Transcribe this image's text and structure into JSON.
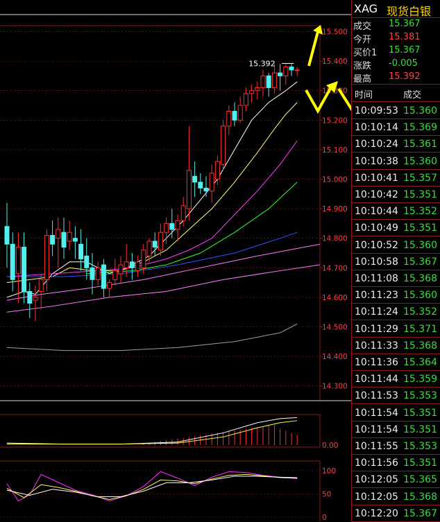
{
  "header": {
    "symbol": "XAG",
    "name": "现货白银"
  },
  "quote": [
    {
      "label": "成交",
      "value": "15.367",
      "color": "green"
    },
    {
      "label": "今开",
      "value": "15.381",
      "color": "red"
    },
    {
      "label": "买价1",
      "value": "15.367",
      "color": "green"
    },
    {
      "label": "涨跌",
      "value": "-0.005",
      "color": "green"
    },
    {
      "label": "最高",
      "value": "15.392",
      "color": "red"
    }
  ],
  "ticks_header": {
    "time": "时间",
    "price": "成交"
  },
  "ticks": [
    {
      "time": "10:09:53",
      "price": "15.360"
    },
    {
      "time": "10:10:14",
      "price": "15.369"
    },
    {
      "time": "10:10:24",
      "price": "15.361"
    },
    {
      "time": "10:10:38",
      "price": "15.360"
    },
    {
      "time": "10:10:41",
      "price": "15.357"
    },
    {
      "time": "10:10:42",
      "price": "15.351"
    },
    {
      "time": "10:10:44",
      "price": "15.352"
    },
    {
      "time": "10:10:49",
      "price": "15.351"
    },
    {
      "time": "10:10:52",
      "price": "15.360"
    },
    {
      "time": "10:10:58",
      "price": "15.367"
    },
    {
      "time": "10:11:08",
      "price": "15.368"
    },
    {
      "time": "10:11:23",
      "price": "15.360"
    },
    {
      "time": "10:11:24",
      "price": "15.352"
    },
    {
      "time": "10:11:29",
      "price": "15.371"
    },
    {
      "time": "10:11:33",
      "price": "15.368"
    },
    {
      "time": "10:11:36",
      "price": "15.364"
    },
    {
      "time": "10:11:44",
      "price": "15.359"
    },
    {
      "time": "10:11:53",
      "price": "15.353"
    },
    {
      "time": "10:11:54",
      "price": "15.351"
    },
    {
      "time": "10:11:54",
      "price": "15.351"
    },
    {
      "time": "10:11:55",
      "price": "15.353"
    },
    {
      "time": "10:11:56",
      "price": "15.351"
    },
    {
      "time": "10:12:05",
      "price": "15.365"
    },
    {
      "time": "10:12:05",
      "price": "15.368"
    },
    {
      "time": "10:12:20",
      "price": "15.367"
    }
  ],
  "colors": {
    "up": "#ff3030",
    "down": "#50f0f0",
    "grid": "#8b1a1a",
    "green": "#3ddc3d",
    "red": "#ff4040"
  },
  "chart_data": [
    {
      "type": "candlestick",
      "ylim": [
        14.25,
        15.52
      ],
      "ticks": [
        "15.500",
        "15.400",
        "15.300",
        "15.200",
        "15.100",
        "15.000",
        "14.900",
        "14.800",
        "14.700",
        "14.600",
        "14.500",
        "14.400",
        "14.300"
      ],
      "annotation": "15.392",
      "candles": [
        {
          "o": 14.84,
          "h": 14.92,
          "l": 14.7,
          "c": 14.78
        },
        {
          "o": 14.78,
          "h": 14.82,
          "l": 14.62,
          "c": 14.66
        },
        {
          "o": 14.68,
          "h": 14.82,
          "l": 14.58,
          "c": 14.77
        },
        {
          "o": 14.77,
          "h": 14.82,
          "l": 14.58,
          "c": 14.62
        },
        {
          "o": 14.62,
          "h": 14.65,
          "l": 14.53,
          "c": 14.58
        },
        {
          "o": 14.59,
          "h": 14.64,
          "l": 14.52,
          "c": 14.6
        },
        {
          "o": 14.62,
          "h": 14.68,
          "l": 14.56,
          "c": 14.66
        },
        {
          "o": 14.66,
          "h": 14.83,
          "l": 14.62,
          "c": 14.81
        },
        {
          "o": 14.81,
          "h": 14.86,
          "l": 14.74,
          "c": 14.78
        },
        {
          "o": 14.8,
          "h": 14.87,
          "l": 14.7,
          "c": 14.83
        },
        {
          "o": 14.82,
          "h": 14.87,
          "l": 14.73,
          "c": 14.77
        },
        {
          "o": 14.79,
          "h": 14.86,
          "l": 14.76,
          "c": 14.82
        },
        {
          "o": 14.8,
          "h": 14.84,
          "l": 14.73,
          "c": 14.79
        },
        {
          "o": 14.78,
          "h": 14.83,
          "l": 14.69,
          "c": 14.73
        },
        {
          "o": 14.74,
          "h": 14.8,
          "l": 14.66,
          "c": 14.7
        },
        {
          "o": 14.7,
          "h": 14.75,
          "l": 14.61,
          "c": 14.66
        },
        {
          "o": 14.66,
          "h": 14.72,
          "l": 14.64,
          "c": 14.7
        },
        {
          "o": 14.71,
          "h": 14.73,
          "l": 14.6,
          "c": 14.63
        },
        {
          "o": 14.63,
          "h": 14.66,
          "l": 14.6,
          "c": 14.65
        },
        {
          "o": 14.66,
          "h": 14.73,
          "l": 14.64,
          "c": 14.69
        },
        {
          "o": 14.68,
          "h": 14.74,
          "l": 14.65,
          "c": 14.71
        },
        {
          "o": 14.7,
          "h": 14.78,
          "l": 14.67,
          "c": 14.72
        },
        {
          "o": 14.72,
          "h": 14.75,
          "l": 14.66,
          "c": 14.7
        },
        {
          "o": 14.69,
          "h": 14.74,
          "l": 14.67,
          "c": 14.72
        },
        {
          "o": 14.7,
          "h": 14.78,
          "l": 14.68,
          "c": 14.76
        },
        {
          "o": 14.74,
          "h": 14.8,
          "l": 14.72,
          "c": 14.79
        },
        {
          "o": 14.79,
          "h": 14.82,
          "l": 14.74,
          "c": 14.77
        },
        {
          "o": 14.76,
          "h": 14.85,
          "l": 14.74,
          "c": 14.82
        },
        {
          "o": 14.82,
          "h": 14.87,
          "l": 14.78,
          "c": 14.85
        },
        {
          "o": 14.85,
          "h": 14.9,
          "l": 14.8,
          "c": 14.83
        },
        {
          "o": 14.83,
          "h": 14.88,
          "l": 14.79,
          "c": 14.86
        },
        {
          "o": 14.86,
          "h": 14.94,
          "l": 14.84,
          "c": 14.91
        },
        {
          "o": 14.9,
          "h": 15.18,
          "l": 14.86,
          "c": 15.03
        },
        {
          "o": 15.01,
          "h": 15.06,
          "l": 14.94,
          "c": 14.99
        },
        {
          "o": 14.99,
          "h": 15.02,
          "l": 14.95,
          "c": 14.97
        },
        {
          "o": 14.97,
          "h": 15.01,
          "l": 14.94,
          "c": 14.96
        },
        {
          "o": 14.96,
          "h": 15.05,
          "l": 14.92,
          "c": 15.02
        },
        {
          "o": 15.0,
          "h": 15.08,
          "l": 14.98,
          "c": 15.06
        },
        {
          "o": 15.05,
          "h": 15.2,
          "l": 15.03,
          "c": 15.18
        },
        {
          "o": 15.18,
          "h": 15.25,
          "l": 15.15,
          "c": 15.23
        },
        {
          "o": 15.23,
          "h": 15.26,
          "l": 15.18,
          "c": 15.2
        },
        {
          "o": 15.2,
          "h": 15.28,
          "l": 15.19,
          "c": 15.25
        },
        {
          "o": 15.25,
          "h": 15.31,
          "l": 15.23,
          "c": 15.29
        },
        {
          "o": 15.29,
          "h": 15.32,
          "l": 15.26,
          "c": 15.3
        },
        {
          "o": 15.3,
          "h": 15.33,
          "l": 15.27,
          "c": 15.31
        },
        {
          "o": 15.31,
          "h": 15.37,
          "l": 15.28,
          "c": 15.35
        },
        {
          "o": 15.35,
          "h": 15.36,
          "l": 15.28,
          "c": 15.31
        },
        {
          "o": 15.31,
          "h": 15.39,
          "l": 15.29,
          "c": 15.36
        },
        {
          "o": 15.36,
          "h": 15.39,
          "l": 15.3,
          "c": 15.35
        },
        {
          "o": 15.35,
          "h": 15.39,
          "l": 15.32,
          "c": 15.38
        },
        {
          "o": 15.38,
          "h": 15.39,
          "l": 15.35,
          "c": 15.37
        },
        {
          "o": 15.37,
          "h": 15.38,
          "l": 15.35,
          "c": 15.37
        }
      ],
      "series": [
        {
          "color": "#ffffff",
          "values": [
            [
              0,
              14.6
            ],
            [
              3,
              14.62
            ],
            [
              5,
              14.61
            ],
            [
              8,
              14.68
            ],
            [
              11,
              14.72
            ],
            [
              14,
              14.72
            ],
            [
              18,
              14.68
            ],
            [
              21,
              14.7
            ],
            [
              25,
              14.74
            ],
            [
              28,
              14.8
            ],
            [
              31,
              14.86
            ],
            [
              34,
              14.93
            ],
            [
              37,
              15.0
            ],
            [
              40,
              15.1
            ],
            [
              43,
              15.2
            ],
            [
              46,
              15.26
            ],
            [
              49,
              15.3
            ],
            [
              51,
              15.33
            ]
          ]
        },
        {
          "color": "#ffff80",
          "values": [
            [
              0,
              14.65
            ],
            [
              4,
              14.66
            ],
            [
              8,
              14.67
            ],
            [
              11,
              14.7
            ],
            [
              15,
              14.69
            ],
            [
              20,
              14.69
            ],
            [
              24,
              14.72
            ],
            [
              28,
              14.76
            ],
            [
              32,
              14.83
            ],
            [
              36,
              14.9
            ],
            [
              40,
              14.99
            ],
            [
              44,
              15.09
            ],
            [
              47,
              15.17
            ],
            [
              49,
              15.22
            ],
            [
              51,
              15.26
            ]
          ]
        },
        {
          "color": "#ff40ff",
          "values": [
            [
              0,
              14.67
            ],
            [
              8,
              14.68
            ],
            [
              16,
              14.69
            ],
            [
              22,
              14.7
            ],
            [
              28,
              14.73
            ],
            [
              32,
              14.76
            ],
            [
              36,
              14.8
            ],
            [
              40,
              14.88
            ],
            [
              44,
              14.96
            ],
            [
              48,
              15.05
            ],
            [
              51,
              15.13
            ]
          ]
        },
        {
          "color": "#30ff30",
          "values": [
            [
              14,
              14.68
            ],
            [
              22,
              14.69
            ],
            [
              28,
              14.71
            ],
            [
              34,
              14.75
            ],
            [
              40,
              14.82
            ],
            [
              46,
              14.9
            ],
            [
              51,
              14.99
            ]
          ]
        },
        {
          "color": "#3050ff",
          "values": [
            [
              0,
              14.67
            ],
            [
              10,
              14.67
            ],
            [
              20,
              14.68
            ],
            [
              30,
              14.71
            ],
            [
              40,
              14.75
            ],
            [
              48,
              14.8
            ],
            [
              51,
              14.82
            ]
          ]
        },
        {
          "color": "#ff80ff",
          "values": [
            [
              0,
              14.59
            ],
            [
              6,
              14.61
            ],
            [
              14,
              14.63
            ],
            [
              24,
              14.66
            ],
            [
              34,
              14.7
            ],
            [
              44,
              14.74
            ],
            [
              55,
              14.78
            ]
          ]
        },
        {
          "color": "#ff80ff",
          "values": [
            [
              0,
              14.55
            ],
            [
              8,
              14.57
            ],
            [
              18,
              14.6
            ],
            [
              28,
              14.62
            ],
            [
              38,
              14.66
            ],
            [
              48,
              14.69
            ],
            [
              55,
              14.71
            ]
          ]
        },
        {
          "color": "#a0a0a0",
          "values": [
            [
              0,
              14.43
            ],
            [
              10,
              14.42
            ],
            [
              20,
              14.42
            ],
            [
              30,
              14.43
            ],
            [
              40,
              14.45
            ],
            [
              48,
              14.48
            ],
            [
              51,
              14.51
            ]
          ]
        }
      ]
    },
    {
      "type": "line",
      "ticks": [
        "0.00"
      ],
      "series": [
        {
          "color": "#ffffff",
          "values": [
            [
              0,
              0.02
            ],
            [
              10,
              0.01
            ],
            [
              20,
              0.01
            ],
            [
              30,
              0.03
            ],
            [
              38,
              0.12
            ],
            [
              44,
              0.22
            ],
            [
              48,
              0.26
            ],
            [
              51,
              0.27
            ]
          ]
        },
        {
          "color": "#ffff40",
          "values": [
            [
              0,
              0.01
            ],
            [
              10,
              0.01
            ],
            [
              20,
              0.01
            ],
            [
              30,
              0.02
            ],
            [
              38,
              0.08
            ],
            [
              44,
              0.17
            ],
            [
              48,
              0.22
            ],
            [
              51,
              0.24
            ]
          ]
        }
      ]
    },
    {
      "type": "line",
      "ticks": [
        "100",
        "50",
        "0"
      ],
      "series": [
        {
          "color": "#ff30ff",
          "values": [
            [
              0,
              72
            ],
            [
              2,
              35
            ],
            [
              4,
              48
            ],
            [
              6,
              92
            ],
            [
              9,
              75
            ],
            [
              12,
              58
            ],
            [
              15,
              48
            ],
            [
              18,
              35
            ],
            [
              21,
              46
            ],
            [
              24,
              66
            ],
            [
              27,
              98
            ],
            [
              30,
              84
            ],
            [
              33,
              68
            ],
            [
              36,
              86
            ],
            [
              39,
              98
            ],
            [
              42,
              96
            ],
            [
              45,
              90
            ],
            [
              48,
              86
            ],
            [
              51,
              83
            ]
          ]
        },
        {
          "color": "#ffff60",
          "values": [
            [
              0,
              62
            ],
            [
              3,
              42
            ],
            [
              6,
              70
            ],
            [
              9,
              64
            ],
            [
              12,
              56
            ],
            [
              15,
              46
            ],
            [
              18,
              38
            ],
            [
              21,
              46
            ],
            [
              24,
              60
            ],
            [
              27,
              80
            ],
            [
              30,
              78
            ],
            [
              33,
              72
            ],
            [
              36,
              82
            ],
            [
              39,
              90
            ],
            [
              42,
              92
            ],
            [
              45,
              89
            ],
            [
              48,
              85
            ],
            [
              51,
              84
            ]
          ]
        },
        {
          "color": "#ffffff",
          "values": [
            [
              0,
              58
            ],
            [
              4,
              47
            ],
            [
              8,
              60
            ],
            [
              12,
              54
            ],
            [
              16,
              44
            ],
            [
              20,
              44
            ],
            [
              24,
              56
            ],
            [
              28,
              74
            ],
            [
              32,
              74
            ],
            [
              36,
              80
            ],
            [
              40,
              88
            ],
            [
              44,
              88
            ],
            [
              48,
              86
            ],
            [
              51,
              85
            ]
          ]
        }
      ]
    }
  ]
}
